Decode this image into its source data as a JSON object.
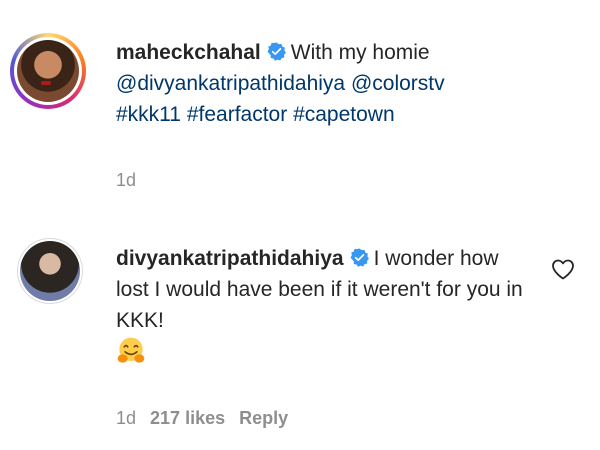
{
  "caption": {
    "username": "maheckchahal",
    "text_intro": "With my homie",
    "mentions": [
      "@divyankatripathidahiya",
      "@colorstv"
    ],
    "hashtags": [
      "#kkk11",
      "#fearfactor",
      "#capetown"
    ],
    "time": "1d"
  },
  "reply": {
    "username": "divyankatripathidahiya",
    "text": "I wonder how lost I would have been if it weren't for you in KKK!",
    "emoji": "hugging-face",
    "time": "1d",
    "likes": "217 likes",
    "reply_label": "Reply"
  },
  "colors": {
    "verified": "#3897f0",
    "link": "#00376b",
    "muted": "#8e8e8e",
    "text": "#262626"
  }
}
